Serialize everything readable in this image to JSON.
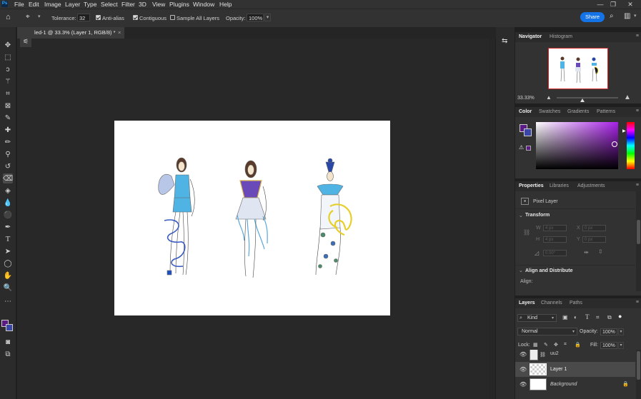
{
  "menubar": {
    "logo": "Ps",
    "items": [
      "File",
      "Edit",
      "Image",
      "Layer",
      "Type",
      "Select",
      "Filter",
      "3D",
      "View",
      "Plugins",
      "Window",
      "Help"
    ],
    "window_controls": {
      "minimize": "—",
      "restore": "❐",
      "close": "✕"
    }
  },
  "options": {
    "tolerance_label": "Tolerance:",
    "tolerance_value": "32",
    "antialias_label": "Anti-alias",
    "antialias_checked": true,
    "contiguous_label": "Contiguous",
    "contiguous_checked": true,
    "sample_all_label": "Sample All Layers",
    "sample_all_checked": false,
    "opacity_label": "Opacity:",
    "opacity_value": "100%",
    "share_label": "Share"
  },
  "document": {
    "tab_title": "led-1 @ 33.3% (Layer 1, RGB/8) *",
    "close_icon": "×"
  },
  "navigator": {
    "tabs": [
      "Navigator",
      "Histogram"
    ],
    "zoom": "33.33%"
  },
  "color_panel": {
    "tabs": [
      "Color",
      "Swatches",
      "Gradients",
      "Patterns"
    ],
    "foreground": "#5b1a86",
    "background": "#3a46a8"
  },
  "properties": {
    "tabs": [
      "Properties",
      "Libraries",
      "Adjustments"
    ],
    "kind": "Pixel Layer",
    "transform_title": "Transform",
    "w_label": "W",
    "w_value": "4 px",
    "x_label": "X",
    "x_value": "0 px",
    "h_label": "H",
    "h_value": "4 px",
    "y_label": "Y",
    "y_value": "0 px",
    "angle_value": "0.00°",
    "align_title": "Align and Distribute",
    "align_label": "Align:"
  },
  "layers": {
    "tabs": [
      "Layers",
      "Channels",
      "Paths"
    ],
    "filter_label": "Kind",
    "blend_mode": "Normal",
    "opacity_label": "Opacity:",
    "opacity_value": "100%",
    "lock_label": "Lock:",
    "fill_label": "Fill:",
    "fill_value": "100%",
    "rows": [
      {
        "name": "uu2"
      },
      {
        "name": "Layer 1"
      },
      {
        "name": "Background"
      }
    ]
  }
}
